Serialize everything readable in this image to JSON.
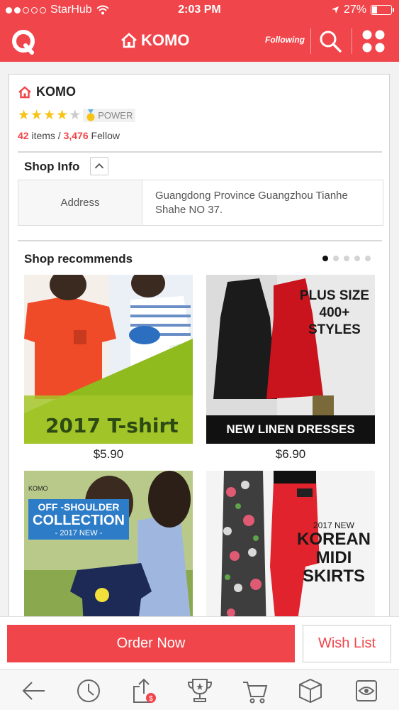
{
  "status_bar": {
    "carrier": "StarHub",
    "time": "2:03 PM",
    "battery": "27%",
    "battery_level": 0.27
  },
  "header": {
    "title": "KOMO",
    "following_label": "Following",
    "icons": [
      "q-logo-icon",
      "home-icon",
      "search-icon",
      "grid-menu-icon"
    ]
  },
  "shop": {
    "name": "KOMO",
    "rating": 4,
    "rating_max": 5,
    "badge": "POWER",
    "items_count": "42",
    "items_label": "items /",
    "followers_count": "3,476",
    "followers_label": "Fellow"
  },
  "shop_info": {
    "title": "Shop Info",
    "address_label": "Address",
    "address_value": "Guangdong Province Guangzhou Tianhe Shahe NO 37."
  },
  "recommends": {
    "title": "Shop recommends",
    "page_count": 5,
    "current_page": 1,
    "products": [
      {
        "banner": "2017 T-shirt",
        "price": "$5.90"
      },
      {
        "banner": "NEW LINEN DRESSES",
        "badge_line1": "PLUS SIZE",
        "badge_line2": "400+",
        "badge_line3": "STYLES",
        "price": "$6.90"
      },
      {
        "brand": "KOMO",
        "line1": "OFF -SHOULDER",
        "line2": "COLLECTION",
        "line3": "- 2017 NEW -"
      },
      {
        "line1": "2017 NEW",
        "line2": "KOREAN",
        "line3": "MIDI",
        "line4": "SKIRTS"
      }
    ]
  },
  "actions": {
    "order_now": "Order Now",
    "wish_list": "Wish List"
  },
  "tab_icons": [
    "back-arrow-icon",
    "history-clock-icon",
    "share-icon",
    "trophy-icon",
    "cart-icon",
    "box-icon",
    "viewed-icon"
  ],
  "colors": {
    "brand": "#f0454a",
    "star": "#f6c417"
  }
}
